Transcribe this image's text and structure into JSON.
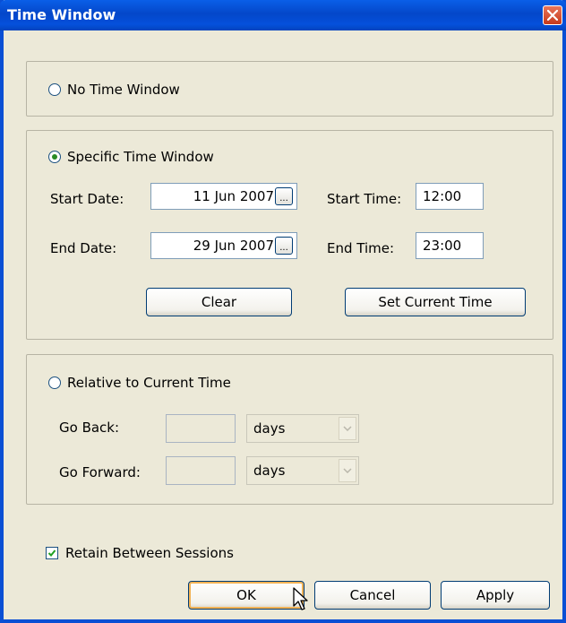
{
  "window": {
    "title": "Time Window"
  },
  "options": {
    "no_time_window": "No Time Window",
    "specific_time_window": "Specific Time Window",
    "relative_to_current_time": "Relative to Current Time"
  },
  "specific": {
    "start_date_label": "Start Date:",
    "start_date_value": "11 Jun 2007",
    "end_date_label": "End Date:",
    "end_date_value": "29 Jun 2007",
    "start_time_label": "Start Time:",
    "start_time_value": "12:00",
    "end_time_label": "End Time:",
    "end_time_value": "23:00",
    "ellipsis_label": "...",
    "clear_label": "Clear",
    "set_current_time_label": "Set Current Time"
  },
  "relative": {
    "go_back_label": "Go Back:",
    "go_back_value": "",
    "go_back_unit": "days",
    "go_forward_label": "Go Forward:",
    "go_forward_value": "",
    "go_forward_unit": "days"
  },
  "retain_label": "Retain Between Sessions",
  "retain_checked": true,
  "buttons": {
    "ok": "OK",
    "cancel": "Cancel",
    "apply": "Apply"
  },
  "selected_option": "specific_time_window",
  "icons": {
    "close": "close-icon",
    "dropdown": "chevron-down-icon",
    "check": "check-icon",
    "cursor": "mouse-pointer-icon"
  },
  "colors": {
    "titlebar": "#0a4fd4",
    "dialog_bg": "#ece9d8",
    "close": "#c6391b",
    "radio_selected": "#2a8b24"
  }
}
